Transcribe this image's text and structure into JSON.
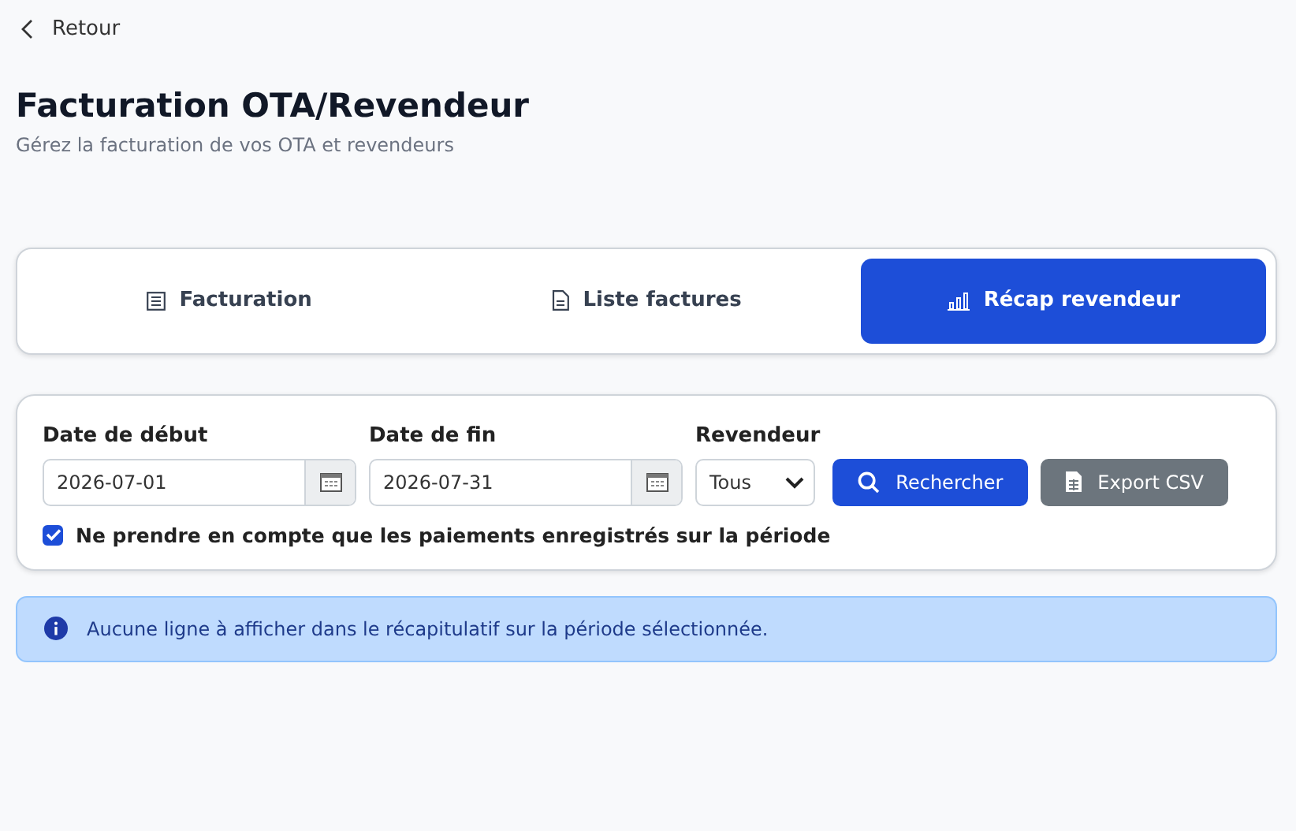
{
  "back_link": "Retour",
  "title": "Facturation OTA/Revendeur",
  "subtitle": "Gérez la facturation de vos OTA et revendeurs",
  "tabs": [
    {
      "label": "Facturation",
      "kind": "list",
      "selected": false
    },
    {
      "label": "Liste factures",
      "kind": "document",
      "selected": false
    },
    {
      "label": "Récap revendeur",
      "kind": "chart",
      "selected": true
    }
  ],
  "filters": {
    "start_date": {
      "label": "Date de début",
      "value": "2026-07-01"
    },
    "end_date": {
      "label": "Date de fin",
      "value": "2026-07-31"
    },
    "reseller": {
      "label": "Revendeur",
      "value": "Tous"
    },
    "search_button": "Rechercher",
    "export_button": "Export CSV",
    "payments_only": {
      "label": "Ne prendre en compte que les paiements enregistrés sur la période",
      "checked": true
    }
  },
  "alert": "Aucune ligne à afficher dans le récapitulatif sur la période sélectionnée."
}
